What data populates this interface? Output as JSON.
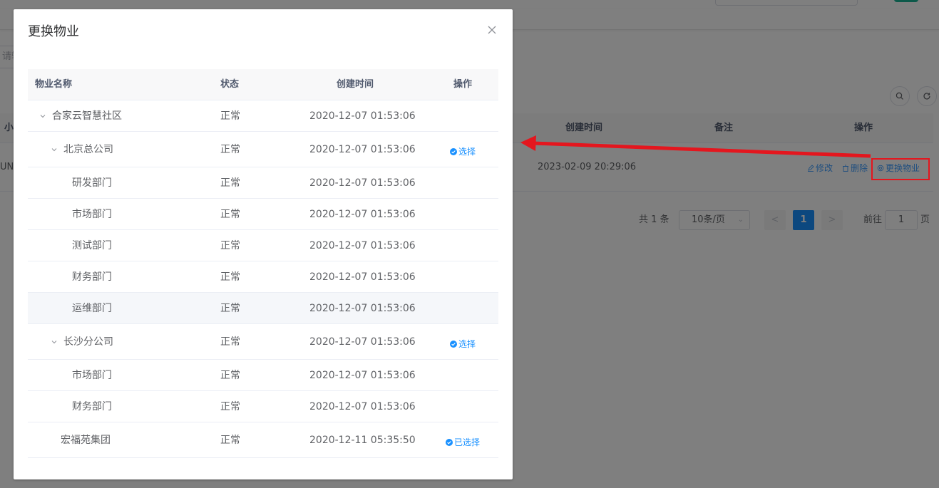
{
  "background": {
    "filter_placeholder": "请输入",
    "table_headers": {
      "first_col_fragment": "小",
      "created_time": "创建时间",
      "remark": "备注",
      "operation": "操作"
    },
    "row": {
      "first_col_fragment": "UNI",
      "created_time": "2023-02-09 20:29:06",
      "ops": [
        "修改",
        "删除",
        "更换物业"
      ]
    },
    "pagination": {
      "total": "共 1 条",
      "page_size": "10条/页",
      "prev": "<",
      "current": "1",
      "next": ">",
      "goto_label": "前往",
      "goto_value": "1",
      "page_suffix": "页"
    }
  },
  "dialog": {
    "title": "更换物业",
    "columns": {
      "name": "物业名称",
      "status": "状态",
      "created_time": "创建时间",
      "operation": "操作"
    },
    "rows": [
      {
        "name": "合家云智慧社区",
        "status": "正常",
        "created_time": "2020-12-07 01:53:06",
        "action": ""
      },
      {
        "name": "北京总公司",
        "status": "正常",
        "created_time": "2020-12-07 01:53:06",
        "action": "选择"
      },
      {
        "name": "研发部门",
        "status": "正常",
        "created_time": "2020-12-07 01:53:06",
        "action": ""
      },
      {
        "name": "市场部门",
        "status": "正常",
        "created_time": "2020-12-07 01:53:06",
        "action": ""
      },
      {
        "name": "测试部门",
        "status": "正常",
        "created_time": "2020-12-07 01:53:06",
        "action": ""
      },
      {
        "name": "财务部门",
        "status": "正常",
        "created_time": "2020-12-07 01:53:06",
        "action": ""
      },
      {
        "name": "运维部门",
        "status": "正常",
        "created_time": "2020-12-07 01:53:06",
        "action": ""
      },
      {
        "name": "长沙分公司",
        "status": "正常",
        "created_time": "2020-12-07 01:53:06",
        "action": "选择"
      },
      {
        "name": "市场部门",
        "status": "正常",
        "created_time": "2020-12-07 01:53:06",
        "action": ""
      },
      {
        "name": "财务部门",
        "status": "正常",
        "created_time": "2020-12-07 01:53:06",
        "action": ""
      },
      {
        "name": "宏福苑集团",
        "status": "正常",
        "created_time": "2020-12-11 05:35:50",
        "action": "已选择"
      }
    ]
  },
  "colors": {
    "primary": "#1890ff",
    "annotation_red": "#e4161e",
    "header_bg": "#f8f8f9"
  }
}
